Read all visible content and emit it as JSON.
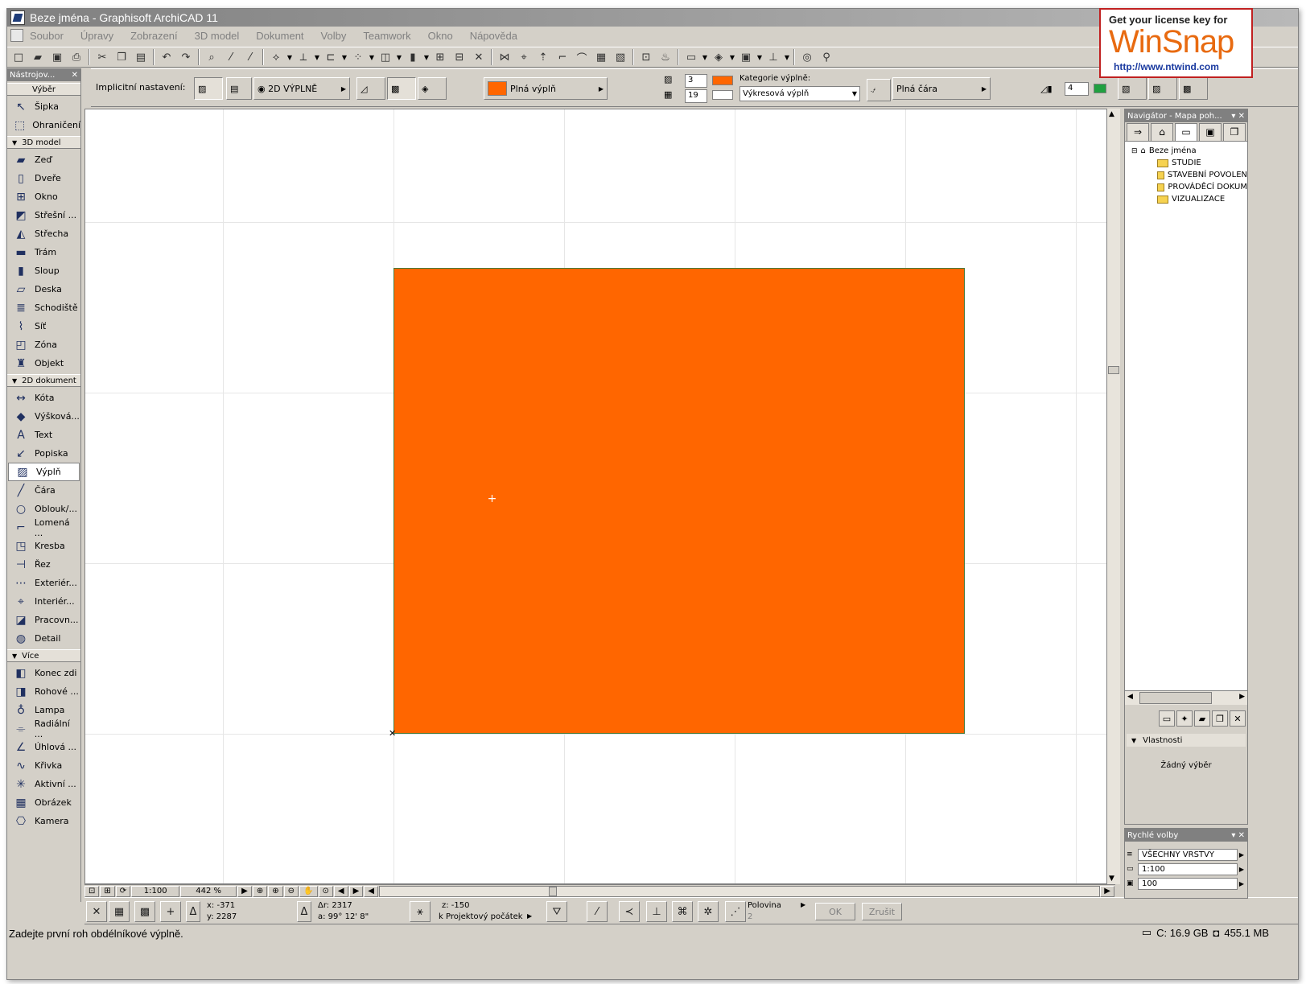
{
  "window": {
    "title": "Beze jména - Graphisoft ArchiCAD 11"
  },
  "menu": [
    "Soubor",
    "Úpravy",
    "Zobrazení",
    "3D model",
    "Dokument",
    "Volby",
    "Teamwork",
    "Okno",
    "Nápověda"
  ],
  "toolbar": {
    "icons": [
      "new-icon",
      "open-icon",
      "save-icon",
      "print-icon",
      "cut-icon",
      "copy-icon",
      "paste-icon",
      "undo-icon",
      "redo-icon",
      "find-icon",
      "pick-icon",
      "inject-icon",
      "magic-wand-icon",
      "trim-icon",
      "align-icon",
      "grid-icon",
      "layers-icon",
      "pen-icon",
      "snap-icon",
      "guide-icon",
      "delete-icon",
      "split-icon",
      "adjust-icon",
      "offset-icon",
      "fillet-icon",
      "curve-icon",
      "group-icon",
      "ungroup-icon",
      "suspend-icon",
      "render-icon",
      "view-icon",
      "3d-window-icon",
      "section-icon",
      "elevation-icon",
      "dimension-icon",
      "walk-icon"
    ]
  },
  "infobox": {
    "default_label": "Implicitní nastavení:",
    "fill_type_label": "2D VÝPLNĚ",
    "fill_name": "Plná výplň",
    "pen_1": "3",
    "pen_2": "19",
    "category_label": "Kategorie výplně:",
    "category_value": "Výkresová výplň",
    "line_type": "Plná čára",
    "pen_3": "4"
  },
  "toolbox": {
    "header": "Nástrojov...",
    "group_top": [
      {
        "label": "Výběr",
        "icon": ""
      }
    ],
    "select_tools": [
      {
        "label": "Šipka",
        "icon": "arrow-icon"
      },
      {
        "label": "Ohraničení",
        "icon": "marquee-icon"
      }
    ],
    "group_3d": "3D model",
    "tools_3d": [
      {
        "label": "Zeď",
        "icon": "wall-icon"
      },
      {
        "label": "Dveře",
        "icon": "door-icon"
      },
      {
        "label": "Okno",
        "icon": "window-icon"
      },
      {
        "label": "Střešní ...",
        "icon": "roof-window-icon"
      },
      {
        "label": "Střecha",
        "icon": "roof-icon"
      },
      {
        "label": "Trám",
        "icon": "beam-icon"
      },
      {
        "label": "Sloup",
        "icon": "column-icon"
      },
      {
        "label": "Deska",
        "icon": "slab-icon"
      },
      {
        "label": "Schodiště",
        "icon": "stair-icon"
      },
      {
        "label": "Síť",
        "icon": "mesh-icon"
      },
      {
        "label": "Zóna",
        "icon": "zone-icon"
      },
      {
        "label": "Objekt",
        "icon": "object-icon"
      }
    ],
    "group_2d": "2D dokument",
    "tools_2d": [
      {
        "label": "Kóta",
        "icon": "dimension-icon"
      },
      {
        "label": "Výšková...",
        "icon": "level-dimension-icon"
      },
      {
        "label": "Text",
        "icon": "text-icon"
      },
      {
        "label": "Popiska",
        "icon": "label-icon"
      },
      {
        "label": "Výplň",
        "icon": "fill-icon"
      },
      {
        "label": "Čára",
        "icon": "line-icon"
      },
      {
        "label": "Oblouk/...",
        "icon": "arc-icon"
      },
      {
        "label": "Lomená ...",
        "icon": "polyline-icon"
      },
      {
        "label": "Kresba",
        "icon": "drawing-icon"
      },
      {
        "label": "Řez",
        "icon": "section-icon"
      },
      {
        "label": "Exteriér...",
        "icon": "elevation-icon"
      },
      {
        "label": "Interiér...",
        "icon": "interior-elevation-icon"
      },
      {
        "label": "Pracovn...",
        "icon": "worksheet-icon"
      },
      {
        "label": "Detail",
        "icon": "detail-icon"
      }
    ],
    "group_more": "Více",
    "tools_more": [
      {
        "label": "Konec zdi",
        "icon": "wall-end-icon"
      },
      {
        "label": "Rohové ...",
        "icon": "corner-window-icon"
      },
      {
        "label": "Lampa",
        "icon": "lamp-icon"
      },
      {
        "label": "Radiální ...",
        "icon": "radial-dimension-icon"
      },
      {
        "label": "Úhlová ...",
        "icon": "angle-dimension-icon"
      },
      {
        "label": "Křivka",
        "icon": "spline-icon"
      },
      {
        "label": "Aktivní ...",
        "icon": "hotspot-icon"
      },
      {
        "label": "Obrázek",
        "icon": "figure-icon"
      },
      {
        "label": "Kamera",
        "icon": "camera-icon"
      }
    ],
    "active_tool": "Výplň"
  },
  "canvas": {
    "fill_color": "#ff6600",
    "scale": "1:100",
    "zoom": "442 %"
  },
  "controlbox": {
    "x": "x: -371",
    "y": "y: 2287",
    "dr": "Δr: 2317",
    "a": "a: 99° 12' 8\"",
    "z": "z: -150",
    "origin": "k Projektový počátek",
    "half": "Polovina",
    "half_num": "2",
    "ok": "OK",
    "cancel": "Zrušit"
  },
  "status": {
    "message": "Zadejte první roh obdélníkové výplně.",
    "disk": "C: 16.9 GB",
    "memory": "455.1 MB"
  },
  "navigator": {
    "title": "Navigátor - Mapa poh...",
    "root": "Beze jména",
    "items": [
      "STUDIE",
      "STAVEBNÍ POVOLEN",
      "PROVÁDĚCÍ DOKUM",
      "VIZUALIZACE"
    ],
    "props_label": "Vlastnosti",
    "no_selection": "Žádný výběr"
  },
  "quick_options": {
    "title": "Rychlé volby",
    "layers": "VŠECHNY VRSTVY",
    "scale": "1:100",
    "pen_set": "100"
  },
  "banner": {
    "line1": "Get your license key for",
    "brand": "WinSnap",
    "url": "http://www.ntwind.com"
  }
}
